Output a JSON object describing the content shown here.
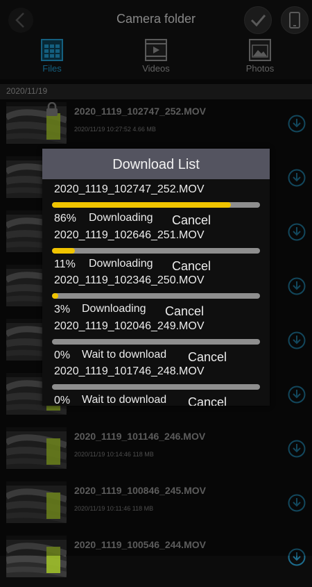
{
  "header": {
    "title": "Camera folder"
  },
  "tabs": [
    {
      "label": "Files",
      "icon": "grid-icon",
      "active": true
    },
    {
      "label": "Videos",
      "icon": "video-icon",
      "active": false
    },
    {
      "label": "Photos",
      "icon": "photo-icon",
      "active": false
    }
  ],
  "date_group": "2020/11/19",
  "files": [
    {
      "name": "2020_1119_102747_252.MOV",
      "meta": "2020/11/19 10:27:52  4.66 MB",
      "locked": true
    },
    {
      "name": "",
      "meta": "",
      "locked": false
    },
    {
      "name": "",
      "meta": "",
      "locked": false
    },
    {
      "name": "",
      "meta": "",
      "locked": false
    },
    {
      "name": "",
      "meta": "",
      "locked": false
    },
    {
      "name": "",
      "meta": "",
      "locked": false
    },
    {
      "name": "2020_1119_101146_246.MOV",
      "meta": "2020/11/19 10:14:46  118 MB",
      "locked": false
    },
    {
      "name": "2020_1119_100846_245.MOV",
      "meta": "2020/11/19 10:11:46  118 MB",
      "locked": false
    },
    {
      "name": "2020_1119_100546_244.MOV",
      "meta": "",
      "locked": false
    }
  ],
  "dialog": {
    "title": "Download List",
    "cancel_label": "Cancel",
    "items": [
      {
        "name": "2020_1119_102747_252.MOV",
        "percent": "86%",
        "progress": 0.86,
        "status": "Downloading"
      },
      {
        "name": "2020_1119_102646_251.MOV",
        "percent": "11%",
        "progress": 0.11,
        "status": "Downloading"
      },
      {
        "name": "2020_1119_102346_250.MOV",
        "percent": "3%",
        "progress": 0.03,
        "status": "Downloading"
      },
      {
        "name": "2020_1119_102046_249.MOV",
        "percent": "0%",
        "progress": 0,
        "status": "Wait to download"
      },
      {
        "name": "2020_1119_101746_248.MOV",
        "percent": "0%",
        "progress": 0,
        "status": "Wait to download"
      }
    ]
  },
  "colors": {
    "accent": "#1f93c4",
    "progress": "#f0c400",
    "dialog_header": "#545460"
  }
}
